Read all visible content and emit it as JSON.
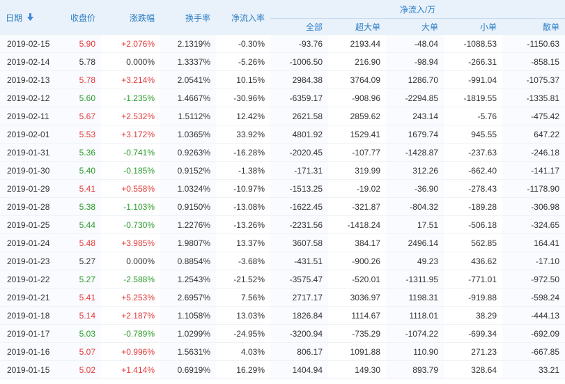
{
  "header": {
    "date": "日期",
    "close": "收盘价",
    "change": "涨跌幅",
    "turnover": "换手率",
    "net_rate": "净流入率",
    "net_group": "净流入/万",
    "all": "全部",
    "xlarge": "超大单",
    "large": "大单",
    "small": "小单",
    "retail": "散单",
    "sort_icon": "sort-down-arrow-icon"
  },
  "colors": {
    "up": "#e23b3b",
    "down": "#2b9c2b",
    "header_text": "#2c7fc4",
    "header_bg": "#e9f1fb"
  },
  "rows": [
    {
      "date": "2019-02-15",
      "close": "5.90",
      "change": "+2.076%",
      "turnover": "2.1319%",
      "net_rate": "-0.30%",
      "all": "-93.76",
      "xlarge": "2193.44",
      "large": "-48.04",
      "small": "-1088.53",
      "retail": "-1150.63",
      "dir": "up"
    },
    {
      "date": "2019-02-14",
      "close": "5.78",
      "change": "0.000%",
      "turnover": "1.3337%",
      "net_rate": "-5.26%",
      "all": "-1006.50",
      "xlarge": "216.90",
      "large": "-98.94",
      "small": "-266.31",
      "retail": "-858.15",
      "dir": "flat"
    },
    {
      "date": "2019-02-13",
      "close": "5.78",
      "change": "+3.214%",
      "turnover": "2.0541%",
      "net_rate": "10.15%",
      "all": "2984.38",
      "xlarge": "3764.09",
      "large": "1286.70",
      "small": "-991.04",
      "retail": "-1075.37",
      "dir": "up"
    },
    {
      "date": "2019-02-12",
      "close": "5.60",
      "change": "-1.235%",
      "turnover": "1.4667%",
      "net_rate": "-30.96%",
      "all": "-6359.17",
      "xlarge": "-908.96",
      "large": "-2294.85",
      "small": "-1819.55",
      "retail": "-1335.81",
      "dir": "down"
    },
    {
      "date": "2019-02-11",
      "close": "5.67",
      "change": "+2.532%",
      "turnover": "1.5112%",
      "net_rate": "12.42%",
      "all": "2621.58",
      "xlarge": "2859.62",
      "large": "243.14",
      "small": "-5.76",
      "retail": "-475.42",
      "dir": "up"
    },
    {
      "date": "2019-02-01",
      "close": "5.53",
      "change": "+3.172%",
      "turnover": "1.0365%",
      "net_rate": "33.92%",
      "all": "4801.92",
      "xlarge": "1529.41",
      "large": "1679.74",
      "small": "945.55",
      "retail": "647.22",
      "dir": "up"
    },
    {
      "date": "2019-01-31",
      "close": "5.36",
      "change": "-0.741%",
      "turnover": "0.9263%",
      "net_rate": "-16.28%",
      "all": "-2020.45",
      "xlarge": "-107.77",
      "large": "-1428.87",
      "small": "-237.63",
      "retail": "-246.18",
      "dir": "down"
    },
    {
      "date": "2019-01-30",
      "close": "5.40",
      "change": "-0.185%",
      "turnover": "0.9152%",
      "net_rate": "-1.38%",
      "all": "-171.31",
      "xlarge": "319.99",
      "large": "312.26",
      "small": "-662.40",
      "retail": "-141.17",
      "dir": "down"
    },
    {
      "date": "2019-01-29",
      "close": "5.41",
      "change": "+0.558%",
      "turnover": "1.0324%",
      "net_rate": "-10.97%",
      "all": "-1513.25",
      "xlarge": "-19.02",
      "large": "-36.90",
      "small": "-278.43",
      "retail": "-1178.90",
      "dir": "up"
    },
    {
      "date": "2019-01-28",
      "close": "5.38",
      "change": "-1.103%",
      "turnover": "0.9150%",
      "net_rate": "-13.08%",
      "all": "-1622.45",
      "xlarge": "-321.87",
      "large": "-804.32",
      "small": "-189.28",
      "retail": "-306.98",
      "dir": "down"
    },
    {
      "date": "2019-01-25",
      "close": "5.44",
      "change": "-0.730%",
      "turnover": "1.2276%",
      "net_rate": "-13.26%",
      "all": "-2231.56",
      "xlarge": "-1418.24",
      "large": "17.51",
      "small": "-506.18",
      "retail": "-324.65",
      "dir": "down"
    },
    {
      "date": "2019-01-24",
      "close": "5.48",
      "change": "+3.985%",
      "turnover": "1.9807%",
      "net_rate": "13.37%",
      "all": "3607.58",
      "xlarge": "384.17",
      "large": "2496.14",
      "small": "562.85",
      "retail": "164.41",
      "dir": "up"
    },
    {
      "date": "2019-01-23",
      "close": "5.27",
      "change": "0.000%",
      "turnover": "0.8854%",
      "net_rate": "-3.68%",
      "all": "-431.51",
      "xlarge": "-900.26",
      "large": "49.23",
      "small": "436.62",
      "retail": "-17.10",
      "dir": "flat"
    },
    {
      "date": "2019-01-22",
      "close": "5.27",
      "change": "-2.588%",
      "turnover": "1.2543%",
      "net_rate": "-21.52%",
      "all": "-3575.47",
      "xlarge": "-520.01",
      "large": "-1311.95",
      "small": "-771.01",
      "retail": "-972.50",
      "dir": "down"
    },
    {
      "date": "2019-01-21",
      "close": "5.41",
      "change": "+5.253%",
      "turnover": "2.6957%",
      "net_rate": "7.56%",
      "all": "2717.17",
      "xlarge": "3036.97",
      "large": "1198.31",
      "small": "-919.88",
      "retail": "-598.24",
      "dir": "up"
    },
    {
      "date": "2019-01-18",
      "close": "5.14",
      "change": "+2.187%",
      "turnover": "1.1058%",
      "net_rate": "13.03%",
      "all": "1826.84",
      "xlarge": "1114.67",
      "large": "1118.01",
      "small": "38.29",
      "retail": "-444.13",
      "dir": "up"
    },
    {
      "date": "2019-01-17",
      "close": "5.03",
      "change": "-0.789%",
      "turnover": "1.0299%",
      "net_rate": "-24.95%",
      "all": "-3200.94",
      "xlarge": "-735.29",
      "large": "-1074.22",
      "small": "-699.34",
      "retail": "-692.09",
      "dir": "down"
    },
    {
      "date": "2019-01-16",
      "close": "5.07",
      "change": "+0.996%",
      "turnover": "1.5631%",
      "net_rate": "4.03%",
      "all": "806.17",
      "xlarge": "1091.88",
      "large": "110.90",
      "small": "271.23",
      "retail": "-667.85",
      "dir": "up"
    },
    {
      "date": "2019-01-15",
      "close": "5.02",
      "change": "+1.414%",
      "turnover": "0.6919%",
      "net_rate": "16.29%",
      "all": "1404.94",
      "xlarge": "149.30",
      "large": "893.79",
      "small": "328.64",
      "retail": "33.21",
      "dir": "up"
    }
  ]
}
